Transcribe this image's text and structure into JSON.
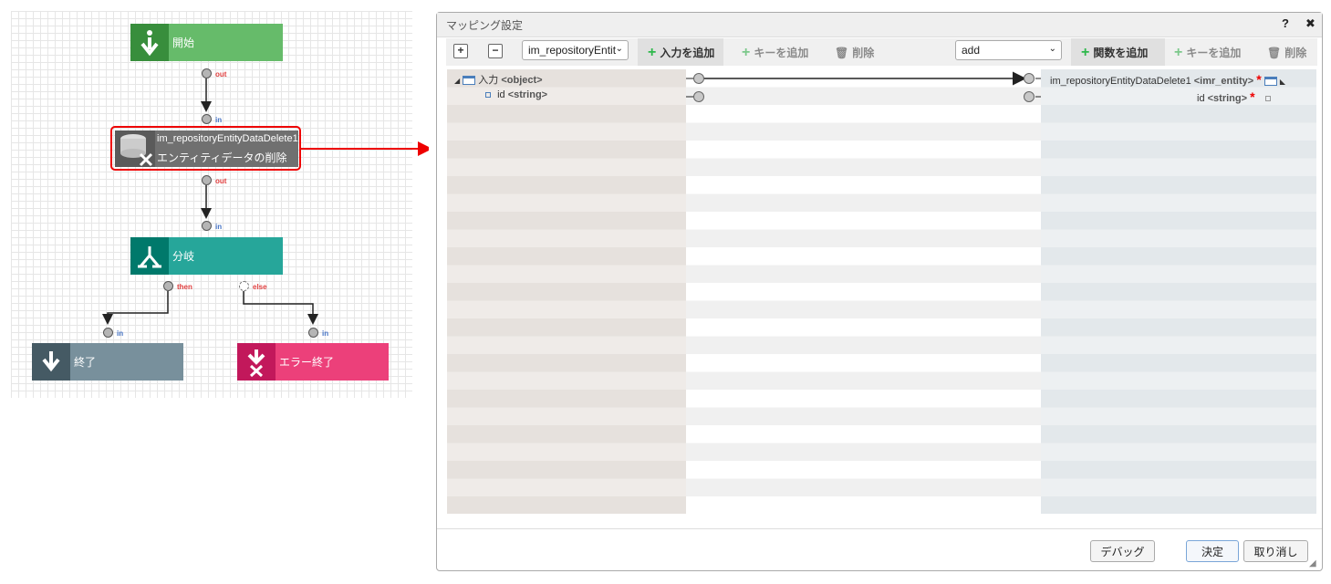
{
  "flow": {
    "nodes": {
      "start": {
        "label": "開始",
        "color": "#66bb6a"
      },
      "delete": {
        "title": "im_repositoryEntityDataDelete1",
        "subtitle": "エンティティデータの削除"
      },
      "branch": {
        "label": "分岐",
        "color": "#26a69a"
      },
      "end": {
        "label": "終了",
        "color": "#78909c"
      },
      "error_end": {
        "label": "エラー終了",
        "color": "#ec407a"
      }
    },
    "ports": {
      "out": "out",
      "in": "in",
      "then": "then",
      "else": "else"
    }
  },
  "dialog": {
    "title": "マッピング設定",
    "help": "?",
    "close": "✖",
    "toolbar": {
      "expand": "+",
      "collapse": "−",
      "input_select": "im_repositoryEntit",
      "add_input": "入力を追加",
      "add_key_left": "キーを追加",
      "delete_left": "削除",
      "func_select": "add",
      "add_function": "関数を追加",
      "add_key_right": "キーを追加",
      "delete_right": "削除"
    },
    "left_tree": [
      {
        "name": "入力",
        "type": "<object>"
      },
      {
        "name": "id",
        "type": "<string>"
      }
    ],
    "right_tree": [
      {
        "name": "im_repositoryEntityDataDelete1",
        "type": "<imr_entity>",
        "required": "*"
      },
      {
        "name": "id",
        "type": "<string>",
        "required": "*"
      }
    ],
    "footer": {
      "debug": "デバッグ",
      "ok": "決定",
      "cancel": "取り消し"
    }
  }
}
